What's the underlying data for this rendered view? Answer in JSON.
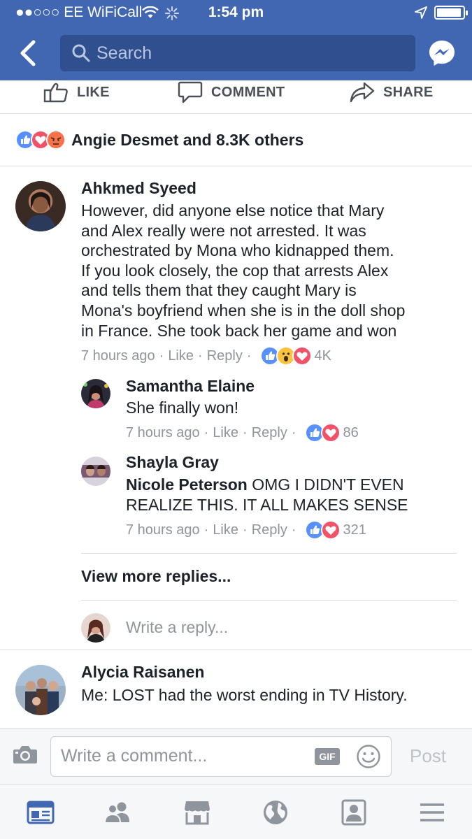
{
  "status_bar": {
    "carrier": "●●○○○ EE WiFiCall",
    "time": "1:54 pm"
  },
  "nav": {
    "search_placeholder": "Search"
  },
  "actions": {
    "like": "LIKE",
    "comment": "COMMENT",
    "share": "SHARE"
  },
  "reactions_summary": {
    "icons": [
      "like-reaction",
      "love-reaction",
      "angry-reaction"
    ],
    "text": "Angie Desmet and 8.3K others"
  },
  "comments": [
    {
      "author": "Ahkmed Syeed",
      "lines": [
        "However, did anyone else notice that Mary",
        "and Alex really were not arrested.  It was",
        "orchestrated by Mona who kidnapped them.",
        "If you look closely, the cop that arrests Alex",
        "and tells them that they caught Mary is",
        "Mona's boyfriend when she is in the doll shop",
        "in France. She took back her game and won"
      ],
      "time": "7 hours ago",
      "like": "Like",
      "reply": "Reply",
      "reactions": [
        "like-reaction",
        "wow-reaction",
        "love-reaction"
      ],
      "count": "4K"
    }
  ],
  "replies": [
    {
      "author": "Samantha Elaine",
      "text": "She finally won!",
      "time": "7 hours ago",
      "like": "Like",
      "reply": "Reply",
      "reactions": [
        "like-reaction",
        "love-reaction"
      ],
      "count": "86"
    },
    {
      "author": "Shayla Gray",
      "mention": "Nicole Peterson",
      "text_first": "OMG I DIDN'T EVEN",
      "text_second": "REALIZE THIS. IT ALL MAKES SENSE",
      "time": "7 hours ago",
      "like": "Like",
      "reply": "Reply",
      "reactions": [
        "like-reaction",
        "love-reaction"
      ],
      "count": "321"
    }
  ],
  "view_more": "View more replies...",
  "reply_placeholder": "Write a reply...",
  "next_comment": {
    "author": "Alycia Raisanen",
    "text": "Me: LOST had the worst ending in TV History."
  },
  "composer": {
    "placeholder": "Write a comment...",
    "gif_label": "GIF",
    "post_label": "Post"
  },
  "tabs": [
    "news-feed",
    "friends",
    "marketplace",
    "notifications",
    "profile",
    "menu"
  ],
  "colors": {
    "brand": "#4267b2",
    "like": "#5890ff",
    "love": "#f25268",
    "wow": "#fcc23d",
    "angry": "#f7714b",
    "muted": "#90949c"
  }
}
